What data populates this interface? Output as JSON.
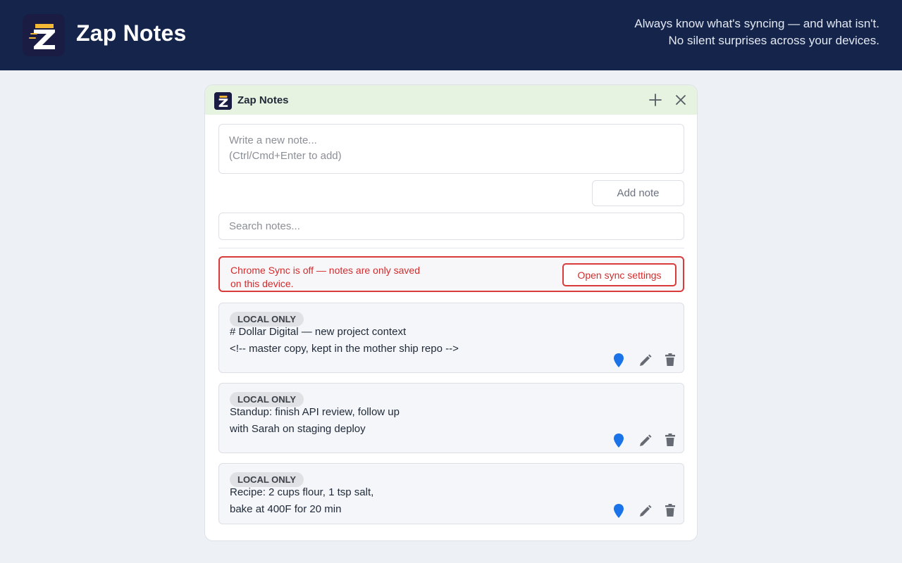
{
  "app": {
    "name": "Zap Notes",
    "tagline_line1": "Always know what's syncing — and what isn't.",
    "tagline_line2": "No silent surprises across your devices."
  },
  "panel": {
    "title": "Zap Notes",
    "add_icon": "plus-icon",
    "close_icon": "close-icon"
  },
  "composer": {
    "placeholder": "Write a new note...\n(Ctrl/Cmd+Enter to add)",
    "value": "",
    "add_button_label": "Add note"
  },
  "search": {
    "placeholder": "Search notes...",
    "value": ""
  },
  "sync_alert": {
    "message": "Chrome Sync is off — notes are only saved on this device.",
    "button_label": "Open sync settings",
    "color": "#d93a3a"
  },
  "notes": [
    {
      "badge": "LOCAL ONLY",
      "text": "# Dollar Digital — new project context\n<!-- master copy, kept in the mother ship repo -->"
    },
    {
      "badge": "LOCAL ONLY",
      "text": "Standup: finish API review, follow up\nwith Sarah on staging deploy"
    },
    {
      "badge": "LOCAL ONLY",
      "text": "Recipe: 2 cups flour, 1 tsp salt,\nbake at 400F for 20 min"
    }
  ],
  "note_actions": [
    "pin-icon",
    "edit-icon",
    "delete-icon"
  ],
  "colors": {
    "header_bg": "#14244a",
    "panel_header_bg": "#e6f3e1",
    "pin": "#1a73e8",
    "alert": "#d93a3a"
  }
}
